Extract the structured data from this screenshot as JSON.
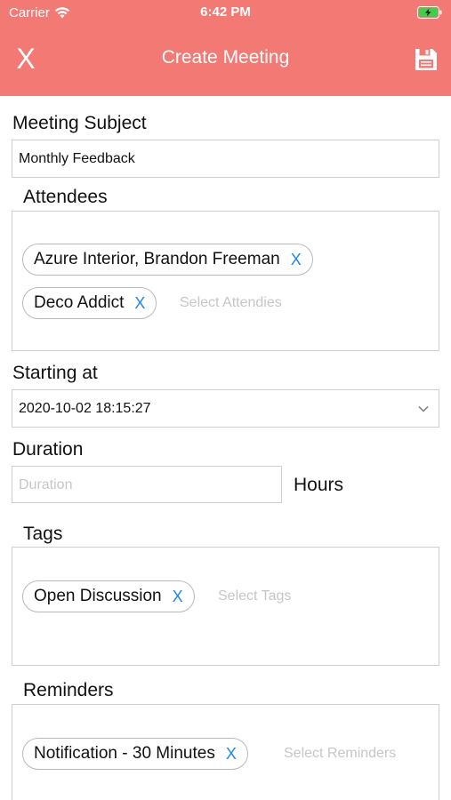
{
  "status_bar": {
    "carrier": "Carrier",
    "time": "6:42 PM"
  },
  "nav": {
    "close_label": "X",
    "title": "Create Meeting"
  },
  "subject": {
    "label": "Meeting Subject",
    "value": "Monthly Feedback"
  },
  "attendees": {
    "label": "Attendees",
    "chips": [
      {
        "text": "Azure Interior, Brandon Freeman",
        "remove": "X"
      },
      {
        "text": "Deco Addict",
        "remove": "X"
      }
    ],
    "placeholder": "Select Attendies"
  },
  "starting_at": {
    "label": "Starting at",
    "value": "2020-10-02 18:15:27"
  },
  "duration": {
    "label": "Duration",
    "placeholder": "Duration",
    "unit": "Hours"
  },
  "tags": {
    "label": "Tags",
    "chips": [
      {
        "text": "Open Discussion",
        "remove": "X"
      }
    ],
    "placeholder": "Select Tags"
  },
  "reminders": {
    "label": "Reminders",
    "chips": [
      {
        "text": "Notification - 30 Minutes",
        "remove": "X"
      }
    ],
    "placeholder": "Select Reminders"
  },
  "colors": {
    "header": "#f37a74",
    "chip_remove": "#1e88e5"
  }
}
